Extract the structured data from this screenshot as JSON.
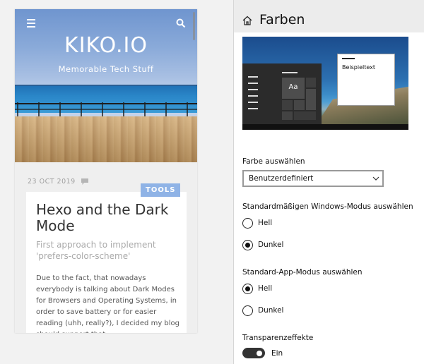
{
  "blog": {
    "site_title": "KIKO.IO",
    "tagline": "Memorable Tech Stuff",
    "date": "23 OCT 2019",
    "tag": "TOOLS",
    "post_title": "Hexo and the Dark Mode",
    "post_subtitle": "First approach to implement 'prefers-color-scheme'",
    "post_body": "Due to the fact, that nowadays everybody is talking about Dark Modes for Browsers and Operating Systems, in order to save battery or for easier reading (uhh, really?), I decided my blog should support that."
  },
  "settings": {
    "title": "Farben",
    "preview": {
      "tile_text": "Aa",
      "window_text": "Beispieltext"
    },
    "color_label": "Farbe auswählen",
    "color_value": "Benutzerdefiniert",
    "windows_mode_label": "Standardmäßigen Windows-Modus auswählen",
    "windows_mode_options": [
      {
        "label": "Hell",
        "checked": false
      },
      {
        "label": "Dunkel",
        "checked": true
      }
    ],
    "app_mode_label": "Standard-App-Modus auswählen",
    "app_mode_options": [
      {
        "label": "Hell",
        "checked": true
      },
      {
        "label": "Dunkel",
        "checked": false
      }
    ],
    "transparency_label": "Transparenzeffekte",
    "transparency_state": "Ein",
    "transparency_on": true
  },
  "icons": {
    "menu": "menu-icon",
    "search": "search-icon",
    "comment": "comment-icon",
    "home": "home-icon",
    "dropdown": "chevron-down-icon"
  },
  "colors": {
    "tag_background": "#8fb3e6",
    "header_background": "#ececec",
    "toggle_on": "#333333"
  }
}
